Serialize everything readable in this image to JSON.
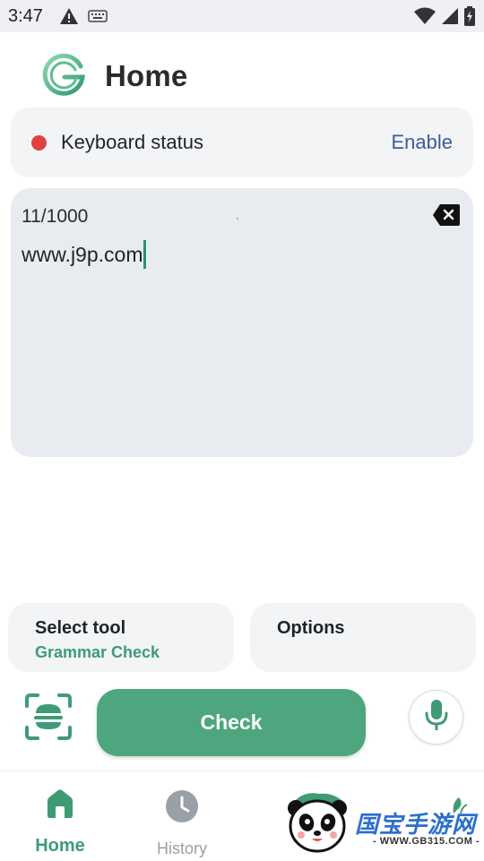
{
  "status_bar": {
    "time": "3:47",
    "left_icons": [
      "warning-icon",
      "keyboard-icon"
    ],
    "right_icons": [
      "wifi-icon",
      "signal-icon",
      "battery-charging-icon"
    ]
  },
  "header": {
    "title": "Home",
    "logo_icon": "grammar-g-logo"
  },
  "keyboard_status": {
    "label": "Keyboard status",
    "action": "Enable",
    "indicator_color": "#e04242"
  },
  "editor": {
    "char_count": "11/1000",
    "text": "www.j9p.com",
    "clear_icon": "clear-text-icon"
  },
  "tool": {
    "title": "Select tool",
    "value": "Grammar Check"
  },
  "options": {
    "title": "Options"
  },
  "actions": {
    "check_label": "Check",
    "scan_icon": "scan-text-icon",
    "mic_icon": "microphone-icon"
  },
  "nav": {
    "home_label": "Home",
    "history_label": "History"
  },
  "watermark": {
    "title": "国宝手游网",
    "url": "- WWW.GB315.COM -"
  },
  "colors": {
    "accent": "#4ea67f",
    "accent_text": "#3f9b76",
    "link": "#3c5a99",
    "card_bg": "#f3f4f5",
    "editor_bg": "#e8ebf0"
  }
}
